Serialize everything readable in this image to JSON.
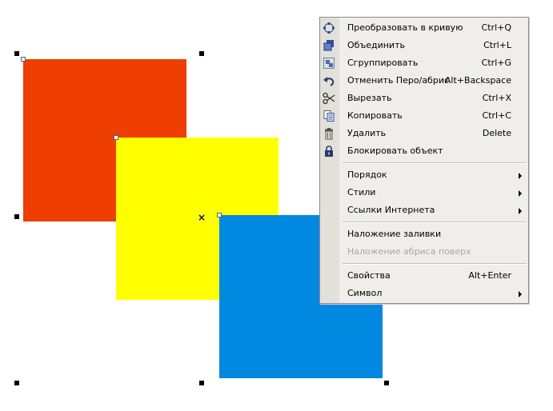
{
  "canvas": {
    "shapes": [
      {
        "name": "red-square",
        "color": "#ee3e00"
      },
      {
        "name": "yellow-square",
        "color": "#ffff00"
      },
      {
        "name": "blue-square",
        "color": "#0088e0"
      }
    ],
    "center_marker_glyph": "×"
  },
  "context_menu": {
    "items": [
      {
        "label": "Преобразовать в кривую",
        "shortcut": "Ctrl+Q",
        "icon": "convert-to-curves-icon"
      },
      {
        "label": "Объединить",
        "shortcut": "Ctrl+L",
        "icon": "combine-icon"
      },
      {
        "label": "Сгруппировать",
        "shortcut": "Ctrl+G",
        "icon": "group-icon"
      },
      {
        "label": "Отменить Перо/абрис",
        "shortcut": "Alt+Backspace",
        "icon": "undo-icon"
      },
      {
        "label": "Вырезать",
        "shortcut": "Ctrl+X",
        "icon": "scissors-icon"
      },
      {
        "label": "Копировать",
        "shortcut": "Ctrl+C",
        "icon": "copy-icon"
      },
      {
        "label": "Удалить",
        "shortcut": "Delete",
        "icon": "trash-icon"
      },
      {
        "label": "Блокировать объект",
        "shortcut": "",
        "icon": "lock-icon"
      },
      {
        "label": "Порядок",
        "submenu": true
      },
      {
        "label": "Стили",
        "submenu": true
      },
      {
        "label": "Ссылки Интернета",
        "submenu": true
      },
      {
        "label": "Наложение заливки"
      },
      {
        "label": "Наложение абриса поверх",
        "disabled": true
      },
      {
        "label": "Свойства",
        "shortcut": "Alt+Enter"
      },
      {
        "label": "Символ",
        "submenu": true
      }
    ]
  }
}
